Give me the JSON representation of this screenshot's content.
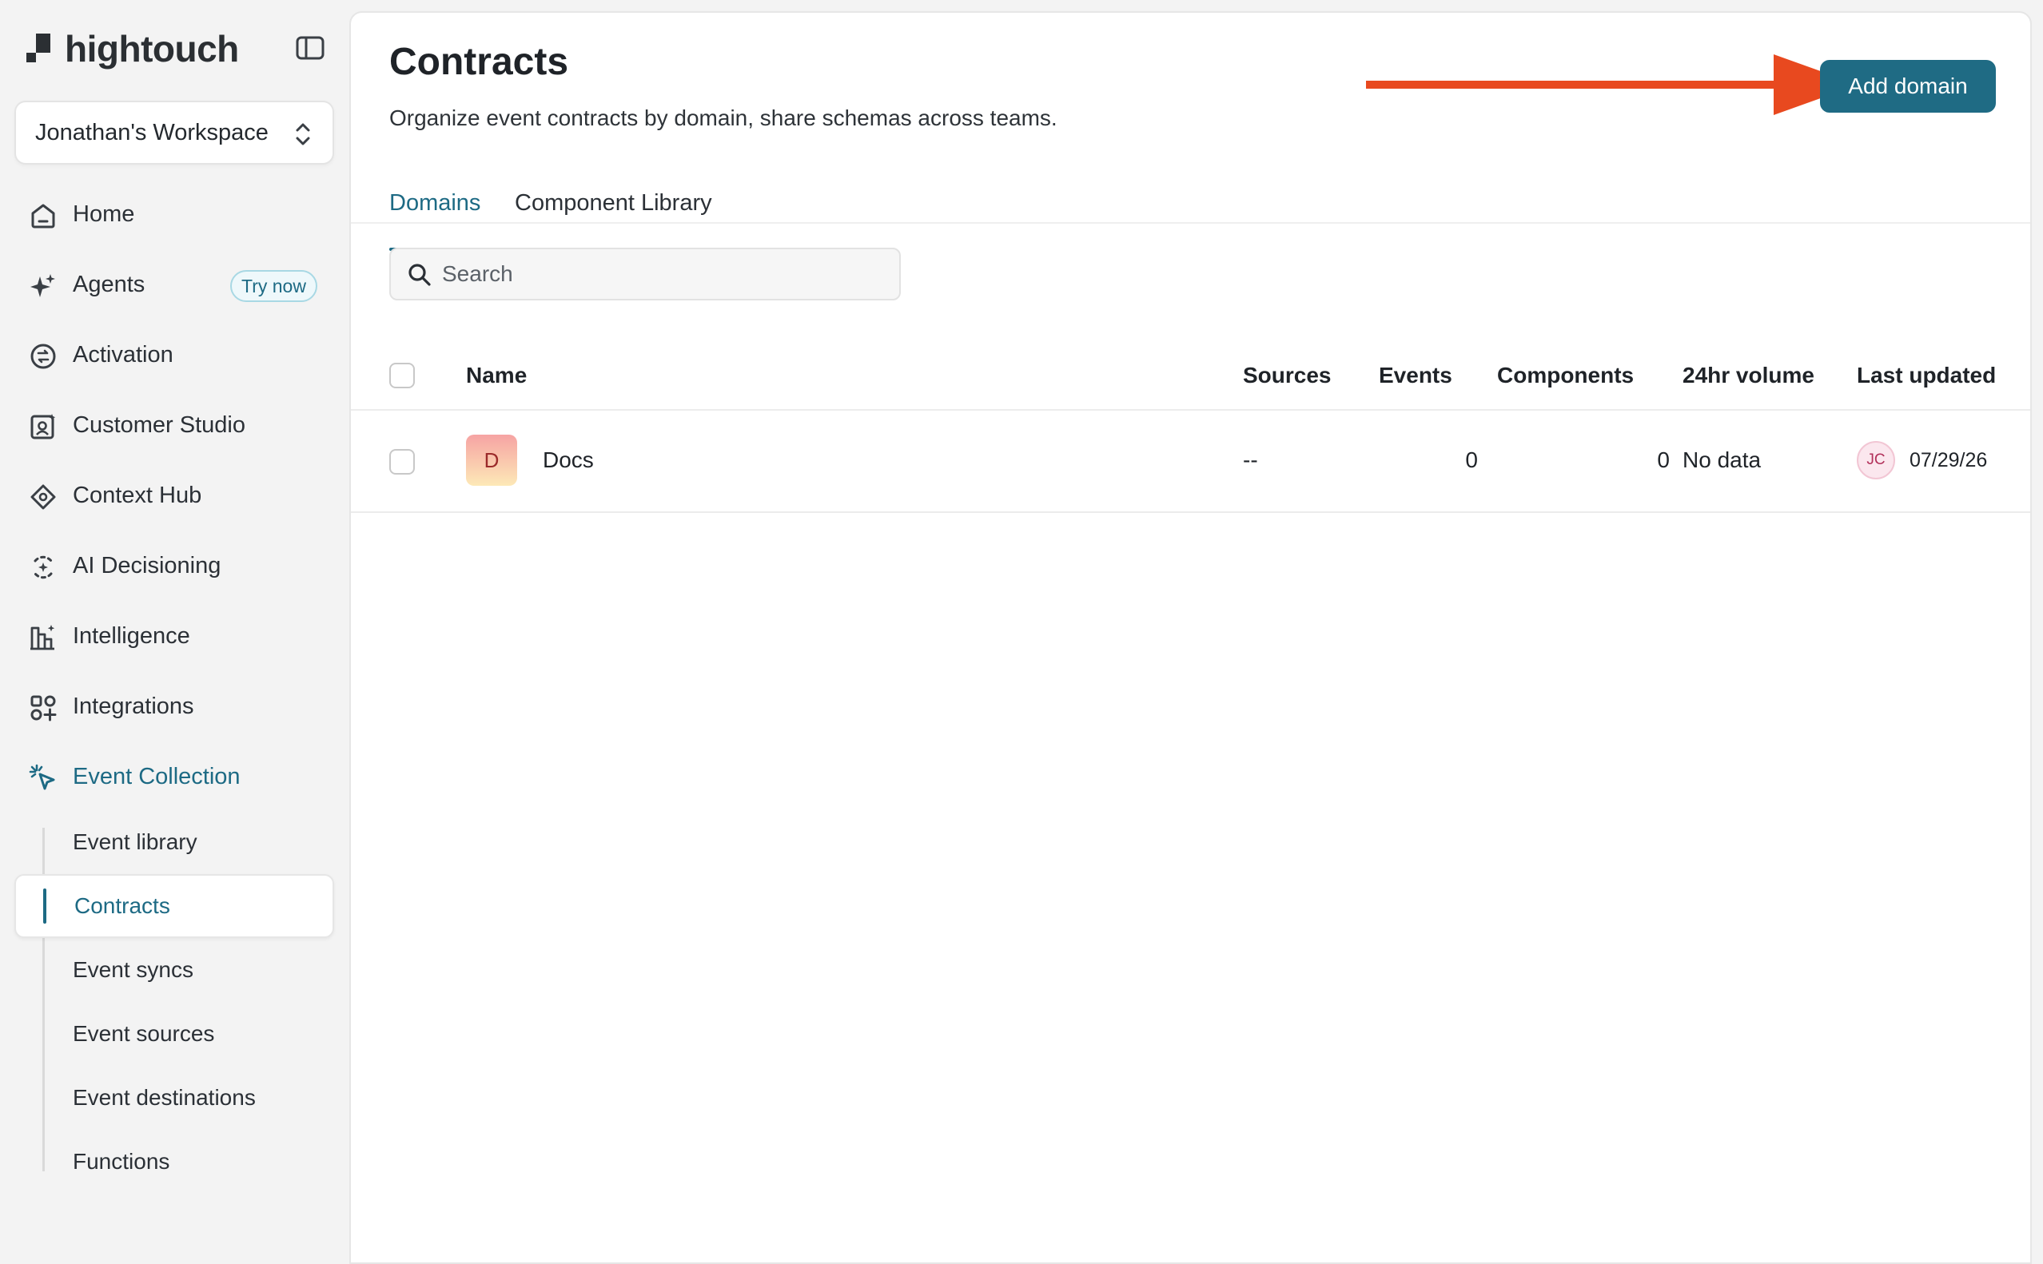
{
  "app": {
    "brand": "hightouch"
  },
  "sidebar": {
    "workspace": "Jonathan's Workspace",
    "items": [
      {
        "label": "Home",
        "icon": "home-icon"
      },
      {
        "label": "Agents",
        "icon": "sparkle-icon",
        "badge": "Try now"
      },
      {
        "label": "Activation",
        "icon": "activation-icon"
      },
      {
        "label": "Customer Studio",
        "icon": "customer-studio-icon"
      },
      {
        "label": "Context Hub",
        "icon": "context-hub-icon"
      },
      {
        "label": "AI Decisioning",
        "icon": "ai-decisioning-icon"
      },
      {
        "label": "Intelligence",
        "icon": "intelligence-icon"
      },
      {
        "label": "Integrations",
        "icon": "integrations-icon"
      },
      {
        "label": "Event Collection",
        "icon": "event-collection-icon",
        "active": true
      }
    ],
    "subitems": [
      {
        "label": "Event library"
      },
      {
        "label": "Contracts",
        "active": true
      },
      {
        "label": "Event syncs"
      },
      {
        "label": "Event sources"
      },
      {
        "label": "Event destinations"
      },
      {
        "label": "Functions"
      }
    ]
  },
  "main": {
    "title": "Contracts",
    "subtitle": "Organize event contracts by domain, share schemas across teams.",
    "add_button": "Add domain",
    "tabs": [
      {
        "label": "Domains",
        "active": true
      },
      {
        "label": "Component Library"
      }
    ],
    "search": {
      "placeholder": "Search",
      "value": ""
    },
    "table": {
      "columns": [
        "Name",
        "Sources",
        "Events",
        "Components",
        "24hr volume",
        "Last updated"
      ],
      "rows": [
        {
          "avatar": "D",
          "name": "Docs",
          "sources": "--",
          "events": "0",
          "components": "0",
          "volume": "No data",
          "updated_by": "JC",
          "updated": "07/29/26"
        }
      ]
    }
  },
  "colors": {
    "accent": "#1d6a84",
    "button": "#1f6b84",
    "annotation_arrow": "#e8491f"
  }
}
